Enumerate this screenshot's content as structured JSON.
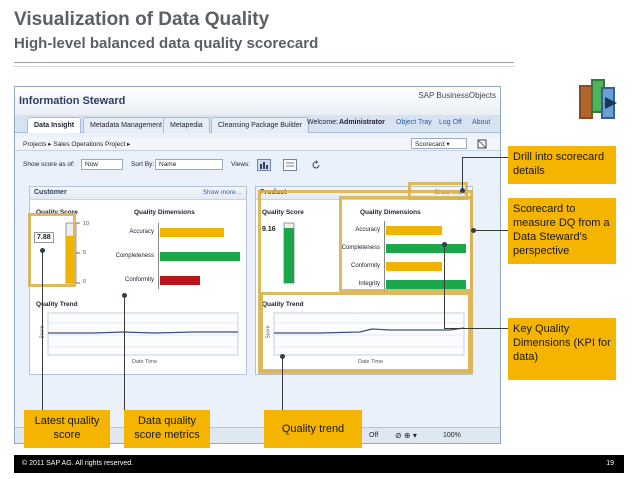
{
  "slide": {
    "title": "Visualization of Data Quality",
    "subtitle": "High-level balanced data quality scorecard",
    "footer_copyright": "© 2011 SAP AG. All rights reserved.",
    "page_number": "19"
  },
  "app": {
    "name": "Information Steward",
    "logo": "SAP BusinessObjects",
    "tabs": [
      "Data Insight",
      "Metadata Management",
      "Metapedia",
      "Cleansing Package Builder"
    ],
    "welcome_label": "Welcome:",
    "user": "Administrator",
    "top_links": [
      "Object Tray",
      "Log Off",
      "About"
    ],
    "breadcrumb": "Projects  ▸  Sales Operations Project  ▸",
    "scorecard_select": "Scorecard",
    "options": {
      "show_score_label": "Show score as of:",
      "show_score_value": "Now",
      "sort_by_label": "Sort By:",
      "sort_by_value": "Name",
      "views_label": "Views:"
    },
    "statusbar": {
      "status": "Off",
      "zoom": "100%"
    }
  },
  "customer_panel": {
    "title": "Customer",
    "show_more": "Show more...",
    "quality_score_label": "Quality Score",
    "score": "7.88",
    "gauge_ticks": [
      "10",
      "5",
      "0"
    ],
    "score_fraction": 0.788,
    "dimensions_label": "Quality Dimensions",
    "dimensions": [
      {
        "name": "Accuracy",
        "value": 0.8,
        "color": "#f0b400"
      },
      {
        "name": "Completeness",
        "value": 1.0,
        "color": "#1ca64a"
      },
      {
        "name": "Conformity",
        "value": 0.5,
        "color": "#b8141b"
      }
    ],
    "trend_label": "Quality Trend",
    "trend_ylabel": "Score",
    "trend_xlabel": "Date Time"
  },
  "product_panel": {
    "title": "Product",
    "show_more": "Show more",
    "quality_score_label": "Quality Score",
    "score": "9.16",
    "score_fraction": 0.916,
    "dimensions_label": "Quality Dimensions",
    "dimensions": [
      {
        "name": "Accuracy",
        "value": 0.7,
        "color": "#f0b400"
      },
      {
        "name": "Completeness",
        "value": 1.0,
        "color": "#1ca64a"
      },
      {
        "name": "Conformity",
        "value": 0.7,
        "color": "#f0b400"
      },
      {
        "name": "Integrity",
        "value": 1.0,
        "color": "#1ca64a"
      }
    ],
    "trend_label": "Quality Trend",
    "trend_ylabel": "Score",
    "trend_xlabel": "Date Time"
  },
  "callouts": {
    "drill": "Drill into scorecard details",
    "scorecard": "Scorecard to measure DQ from a Data Steward's perspective",
    "kpi": "Key Quality Dimensions (KPI for data)",
    "latest": "Latest quality score",
    "metrics": "Data quality score metrics",
    "trend": "Quality trend"
  },
  "colors": {
    "callout": "#f5b400",
    "highlight": "#d9b24e",
    "good": "#1ca64a",
    "warn": "#f0b400",
    "bad": "#b8141b"
  },
  "icons": [
    "export-icon",
    "help-icon",
    "scorecard-view-icon",
    "table-view-icon",
    "refresh-icon",
    "maximize-icon"
  ]
}
